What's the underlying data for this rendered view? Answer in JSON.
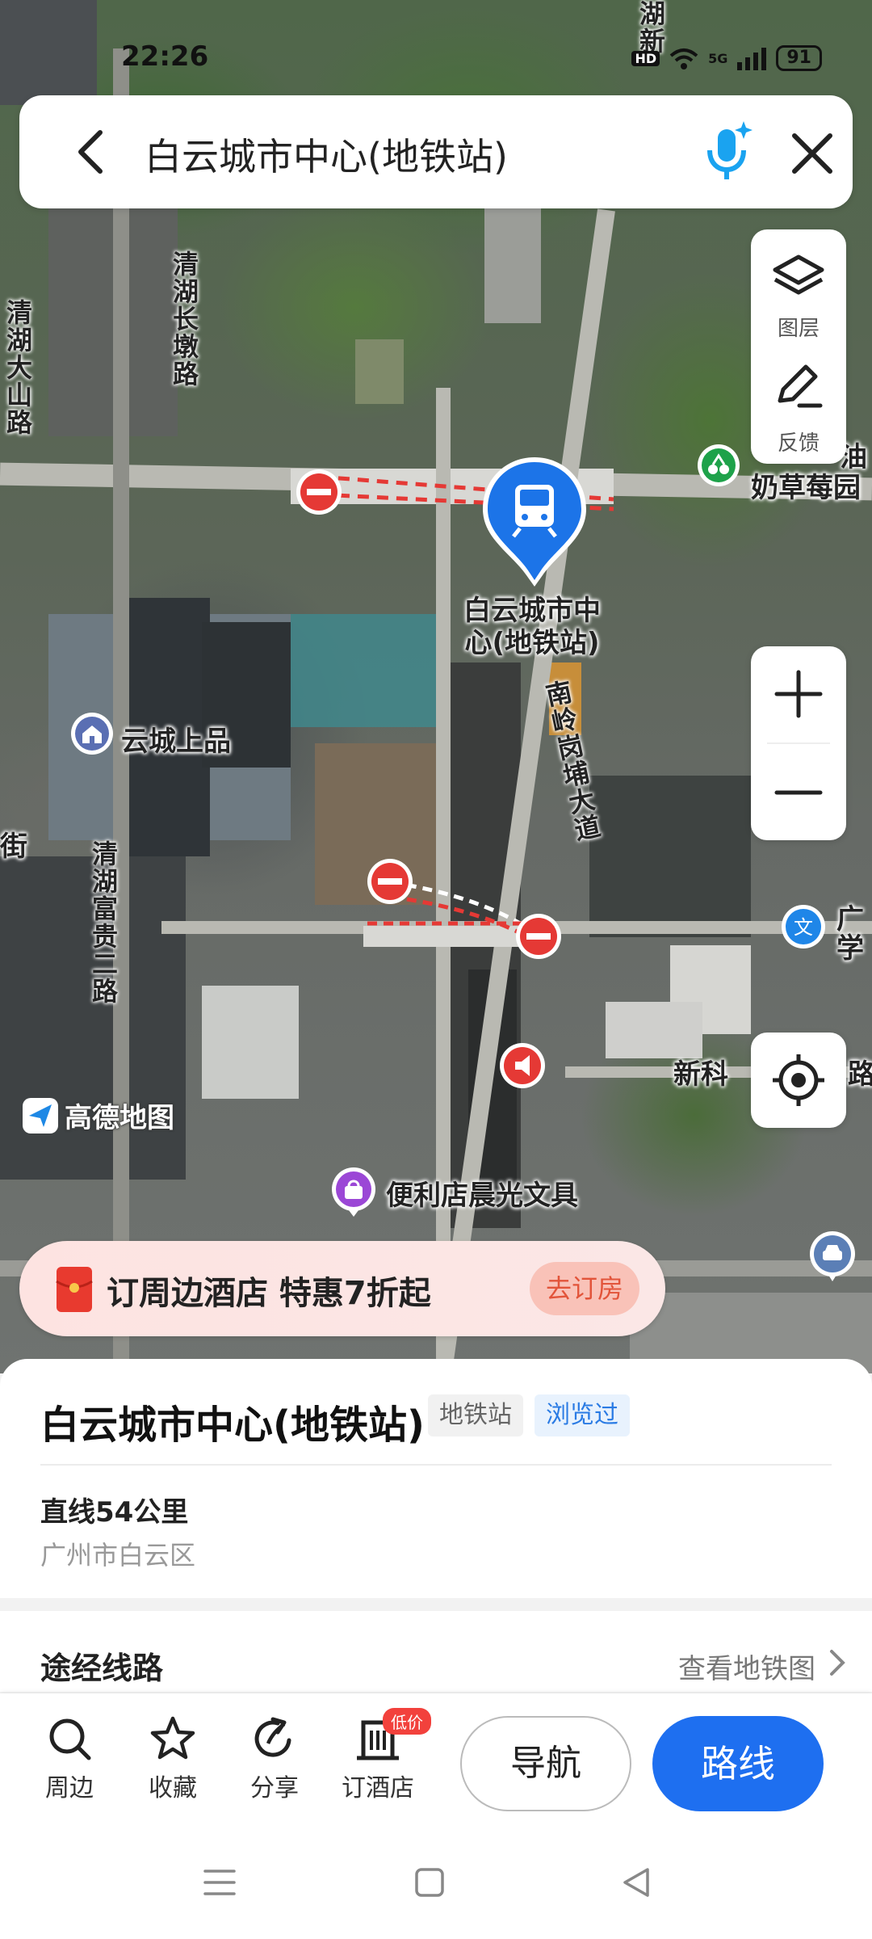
{
  "status_bar": {
    "time": "22:26",
    "network": "HD",
    "signal": "5G",
    "battery": "91"
  },
  "search": {
    "title": "白云城市中心(地铁站)"
  },
  "map_controls": {
    "layers_label": "图层",
    "feedback_label": "反馈"
  },
  "map_labels": {
    "station_name": "白云城市中\n心(地铁站)",
    "road_qinghu_changdun": "清湖长墩路",
    "road_qinghu_dashan": "清湖大山路",
    "road_qinghu_fugui": "清湖富贵二路",
    "road_nanling": "南岭岗埔大道",
    "poi_yuncheng": "云城上品",
    "poi_strawberry": "奶草莓园",
    "poi_strawberry_top": "油",
    "poi_shop": "便利店晨光文具",
    "poi_xinke": "新科",
    "road_partial_right": "路",
    "poi_guang": "广",
    "poi_xue": "学",
    "road_partial_left": "街",
    "top_road_a": "新",
    "top_road_b": "湖",
    "brand": "高德地图"
  },
  "promo": {
    "text": "订周边酒店 特惠7折起",
    "button": "去订房"
  },
  "place": {
    "name": "白云城市中心(地铁站)",
    "type_tag": "地铁站",
    "visited_tag": "浏览过",
    "distance": "直线54公里",
    "district": "广州市白云区"
  },
  "routes_section": {
    "title": "途经线路",
    "link": "查看地铁图"
  },
  "actions": {
    "nearby": "周边",
    "favorite": "收藏",
    "share": "分享",
    "hotel": "订酒店",
    "hotel_badge": "低价",
    "navigate": "导航",
    "route": "路线"
  },
  "colors": {
    "accent": "#1e6ff0",
    "promo_text": "#e2543a",
    "badge": "#f2413c",
    "visited_tag": "#2a7be4"
  }
}
